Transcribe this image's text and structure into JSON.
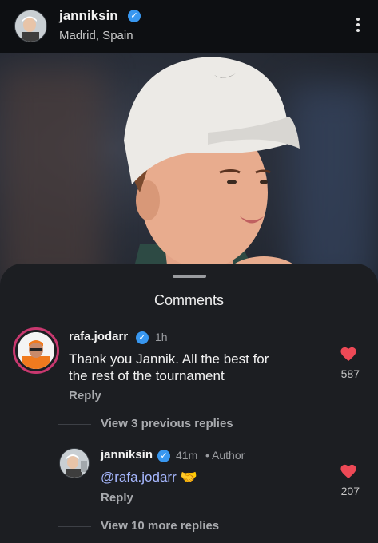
{
  "header": {
    "username": "janniksin",
    "location": "Madrid, Spain"
  },
  "sheet": {
    "title": "Comments"
  },
  "comments": [
    {
      "username": "rafa.jodarr",
      "time": "1h",
      "text_line1": "Thank you Jannik. All the best for",
      "text_line2": "the rest of the tournament",
      "reply_label": "Reply",
      "likes": "587",
      "view_replies": "View 3 previous replies"
    },
    {
      "username": "janniksin",
      "time": "41m",
      "author_label": "• Author",
      "mention": "@rafa.jodarr",
      "emoji": "🤝",
      "reply_label": "Reply",
      "likes": "207",
      "view_more": "View 10 more replies"
    }
  ],
  "colors": {
    "verified": "#3897f0",
    "like_heart": "#ed4956",
    "story_ring": "#c8386f",
    "mention": "#a7b8ff"
  }
}
